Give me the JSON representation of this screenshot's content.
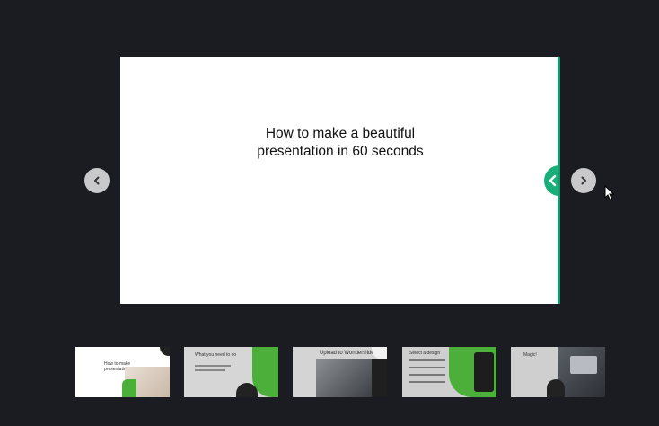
{
  "slide": {
    "title_line1": "How to make a beautiful",
    "title_line2": "presentation in 60 seconds"
  },
  "navigation": {
    "prev_icon": "chevron-left-icon",
    "next_icon": "chevron-right-icon",
    "edge_tab_icon": "chevron-left-icon"
  },
  "thumbnails": [
    {
      "label": "How to make presentation"
    },
    {
      "label": "What you need to do"
    },
    {
      "label": "Upload to Wonderslide"
    },
    {
      "label": "Select a design"
    },
    {
      "label": "Magic!"
    }
  ],
  "colors": {
    "background": "#1b1c21",
    "accent": "#1aae7a",
    "thumb_green": "#4caf3a"
  }
}
